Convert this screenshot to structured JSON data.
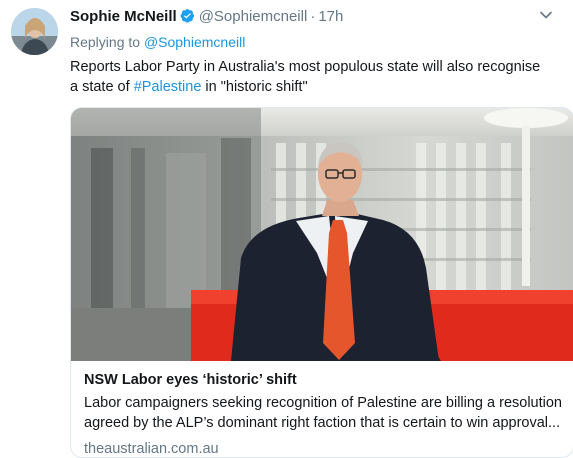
{
  "tweet": {
    "author_name": "Sophie McNeill",
    "handle": "@Sophiemcneill",
    "separator": "·",
    "time": "17h",
    "replying_label": "Replying to",
    "replying_handle": "@Sophiemcneill",
    "text_before": "Reports Labor Party in Australia's most populous state will also recognise a state of ",
    "hashtag": "#Palestine",
    "text_after": " in \"historic shift\""
  },
  "card": {
    "title": "NSW Labor eyes ‘historic’ shift",
    "description": "Labor campaigners seeking recognition of Palestine are billing a resolution agreed by the ALP’s dominant right faction that is certain to win approval...",
    "domain": "theaustralian.com.au"
  },
  "icons": {
    "verified": "verified-badge-icon",
    "more": "chevron-down-icon"
  },
  "colors": {
    "link": "#1b95e0",
    "secondary_text": "#657786",
    "card_border": "#e1e8ed",
    "sofa_red": "#e02a1c"
  }
}
